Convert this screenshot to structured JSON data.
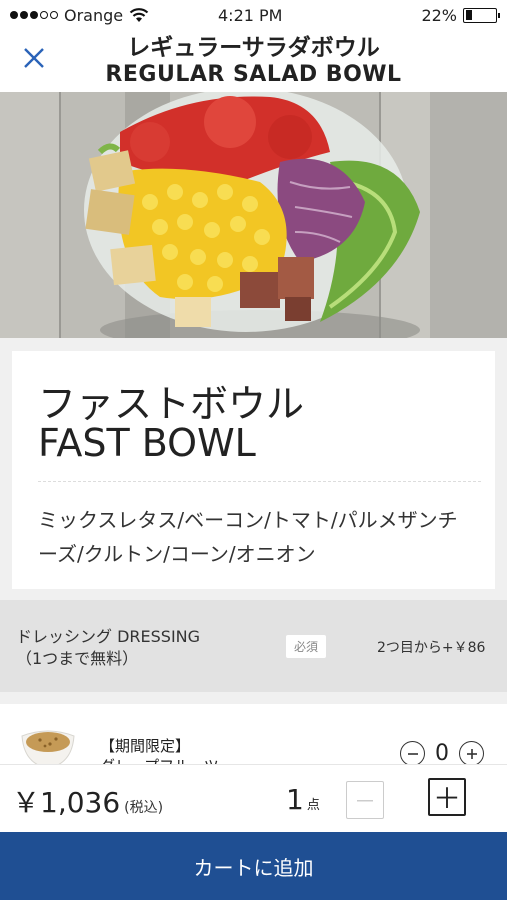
{
  "status_bar": {
    "carrier": "Orange",
    "time": "4:21 PM",
    "battery": "22%",
    "battery_level": 0.22,
    "icons": [
      "signal-dots",
      "wifi-icon",
      "battery-icon"
    ]
  },
  "header": {
    "title_ja": "レギュラーサラダボウル",
    "title_en": "REGULAR SALAD BOWL",
    "close_icon": "close-icon",
    "accent_color": "#2a63b8"
  },
  "hero": {
    "image": "salad-bowl-photo"
  },
  "product": {
    "name_ja": "ファストボウル",
    "name_en": "FAST BOWL",
    "ingredients": "ミックスレタス/ベーコン/トマト/パルメザンチーズ/クルトン/コーン/オニオン"
  },
  "dressing": {
    "title_line1": "ドレッシング DRESSING",
    "title_line2": "（1つまで無料）",
    "required_badge": "必須",
    "extra_price": "2つ目から+￥86",
    "item": {
      "name_line1": "【期間限定】",
      "name_line2": "グレープフルーツ",
      "quantity": "0",
      "minus_icon": "minus-circle-icon",
      "plus_icon": "plus-circle-icon"
    }
  },
  "order": {
    "price": "￥1,036",
    "tax_note": "(税込)",
    "count": "1",
    "count_unit": "点",
    "minus_label": "－",
    "plus_label": "＋"
  },
  "cart": {
    "button_label": "カートに追加",
    "button_color": "#1f4f93"
  }
}
